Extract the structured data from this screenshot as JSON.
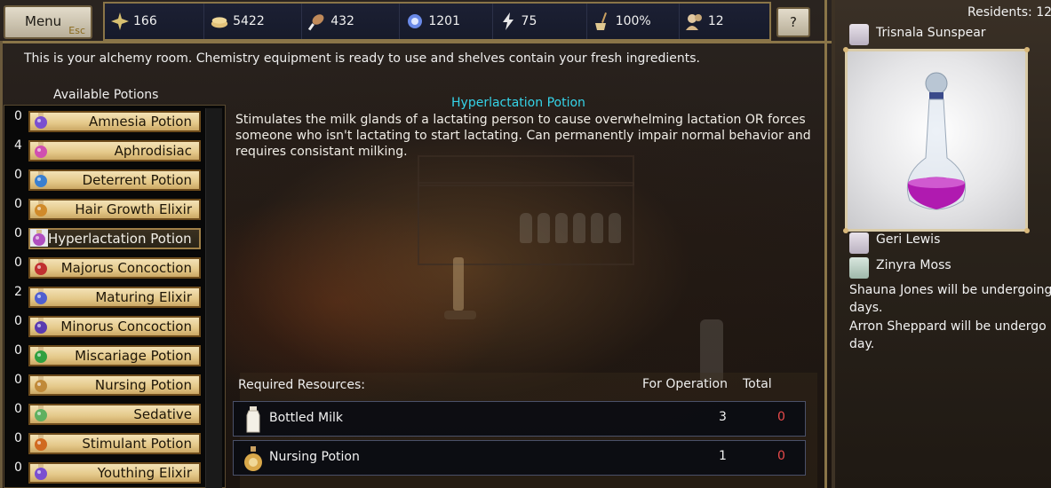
{
  "topbar": {
    "menu_label": "Menu",
    "menu_hotkey": "Esc",
    "help_label": "?",
    "resources": [
      {
        "icon": "fame-icon",
        "value": "166"
      },
      {
        "icon": "gold-icon",
        "value": "5422"
      },
      {
        "icon": "food-icon",
        "value": "432"
      },
      {
        "icon": "mana-icon",
        "value": "1201"
      },
      {
        "icon": "energy-icon",
        "value": "75"
      },
      {
        "icon": "cleanliness-icon",
        "value": "100%"
      },
      {
        "icon": "population-icon",
        "value": "12"
      }
    ]
  },
  "room": {
    "description": "This is your alchemy room. Chemistry equipment is ready to use and shelves contain your fresh ingredients."
  },
  "potions": {
    "title": "Available Potions",
    "items": [
      {
        "count": "0",
        "name": "Amnesia Potion",
        "color": "#7a4fd0"
      },
      {
        "count": "4",
        "name": "Aphrodisiac",
        "color": "#d04fb0"
      },
      {
        "count": "0",
        "name": "Deterrent Potion",
        "color": "#3a7fd0"
      },
      {
        "count": "0",
        "name": "Hair Growth Elixir",
        "color": "#d08a2a"
      },
      {
        "count": "0",
        "name": "Hyperlactation Potion",
        "color": "#b04fc0",
        "selected": true
      },
      {
        "count": "0",
        "name": "Majorus Concoction",
        "color": "#c03030"
      },
      {
        "count": "2",
        "name": "Maturing Elixir",
        "color": "#4f5fd0"
      },
      {
        "count": "0",
        "name": "Minorus Concoction",
        "color": "#5a3ab0"
      },
      {
        "count": "0",
        "name": "Miscariage Potion",
        "color": "#30a040"
      },
      {
        "count": "0",
        "name": "Nursing Potion",
        "color": "#c08a3a"
      },
      {
        "count": "0",
        "name": "Sedative",
        "color": "#60b060"
      },
      {
        "count": "0",
        "name": "Stimulant Potion",
        "color": "#d06a20"
      },
      {
        "count": "0",
        "name": "Youthing Elixir",
        "color": "#7a4fd0"
      }
    ]
  },
  "detail": {
    "title": "Hyperlactation Potion",
    "description": "Stimulates the milk glands of a lactating person to cause overwhelming lactation OR forces someone who isn't lactating to start lactating. Can permanently impair normal behavior and requires consistant milking.",
    "required_label": "Required Resources:",
    "for_operation_label": "For Operation",
    "total_label": "Total",
    "requirements": [
      {
        "name": "Bottled Milk",
        "icon": "milk-bottle-icon",
        "for_operation": "3",
        "total": "0"
      },
      {
        "name": "Nursing Potion",
        "icon": "nursing-potion-icon",
        "for_operation": "1",
        "total": "0"
      }
    ]
  },
  "sidebar": {
    "residents_label": "Residents: 12",
    "featured_resident": "Trisnala Sunspear",
    "residents": [
      "Geri Lewis",
      "Zinyra Moss"
    ],
    "notes": [
      "Shauna Jones will be undergoing",
      "days.",
      "Arron Sheppard will be undergo",
      "day."
    ]
  }
}
